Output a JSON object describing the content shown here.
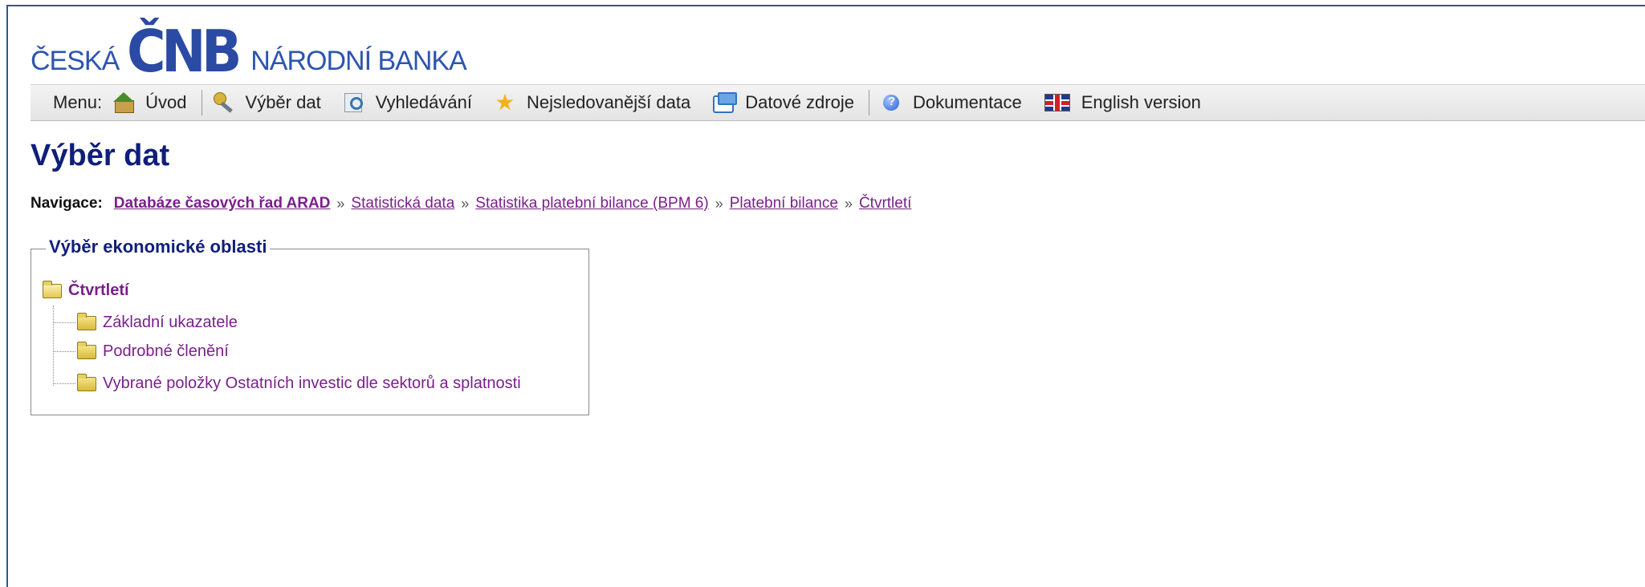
{
  "logo": {
    "left_text": "ČESKÁ",
    "mark_text": "ČNB",
    "right_text": "NÁRODNÍ BANKA"
  },
  "menu": {
    "label": "Menu:",
    "items": [
      {
        "label": "Úvod",
        "icon": "home-icon"
      },
      {
        "label": "Výběr dat",
        "icon": "key-icon"
      },
      {
        "label": "Vyhledávání",
        "icon": "search-icon"
      },
      {
        "label": "Nejsledovanější data",
        "icon": "star-icon"
      },
      {
        "label": "Datové zdroje",
        "icon": "data-source-icon"
      },
      {
        "label": "Dokumentace",
        "icon": "help-icon"
      },
      {
        "label": "English version",
        "icon": "uk-flag-icon"
      }
    ]
  },
  "page": {
    "title": "Výběr dat"
  },
  "breadcrumb": {
    "label": "Navigace:",
    "separator": "»",
    "items": [
      "Databáze časových řad ARAD",
      "Statistická data",
      "Statistika platební bilance (BPM 6)",
      "Platební bilance",
      "Čtvrtletí"
    ]
  },
  "economic_area": {
    "legend": "Výběr ekonomické oblasti",
    "root": "Čtvrtletí",
    "children": [
      "Základní ukazatele",
      "Podrobné členění",
      "Vybrané položky Ostatních investic dle sektorů a splatnosti"
    ]
  }
}
